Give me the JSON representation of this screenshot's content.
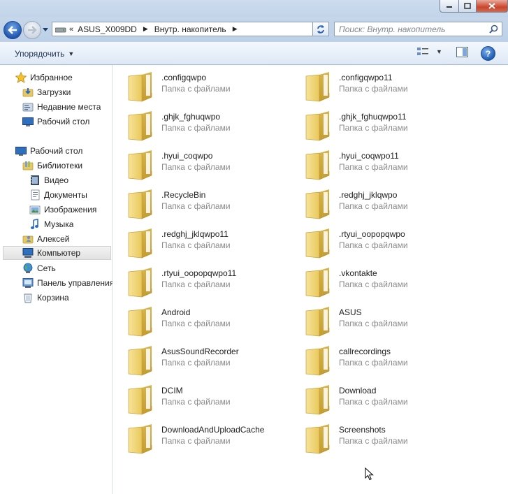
{
  "address": {
    "overflow": "«",
    "crumbs": [
      "ASUS_X009DD",
      "Внутр. накопитель"
    ]
  },
  "search": {
    "placeholder": "Поиск: Внутр. накопитель"
  },
  "toolbar": {
    "organize_label": "Упорядочить"
  },
  "sidebar": {
    "favorites": {
      "header": "Избранное",
      "items": [
        "Загрузки",
        "Недавние места",
        "Рабочий стол"
      ]
    },
    "desktop": "Рабочий стол",
    "libraries": {
      "header": "Библиотеки",
      "items": [
        "Видео",
        "Документы",
        "Изображения",
        "Музыка"
      ]
    },
    "user": "Алексей",
    "computer": "Компьютер",
    "network": "Сеть",
    "control_panel": "Панель управления",
    "recycle": "Корзина",
    "selected": "Компьютер"
  },
  "folder_type": "Папка с файлами",
  "folders": [
    ".configqwpo",
    ".configqwpo11",
    ".ghjk_fghuqwpo",
    ".ghjk_fghuqwpo11",
    ".hyui_coqwpo",
    ".hyui_coqwpo11",
    ".RecycleBin",
    ".redghj_jklqwpo",
    ".redghj_jklqwpo11",
    ".rtyui_oopopqwpo",
    ".rtyui_oopopqwpo11",
    ".vkontakte",
    "Android",
    "ASUS",
    "AsusSoundRecorder",
    "callrecordings",
    "DCIM",
    "Download",
    "DownloadAndUploadCache",
    "Screenshots"
  ],
  "colors": {
    "folder": "#f2d77a",
    "chrome": "#dce7f4",
    "selection": "#e5e5e5"
  }
}
